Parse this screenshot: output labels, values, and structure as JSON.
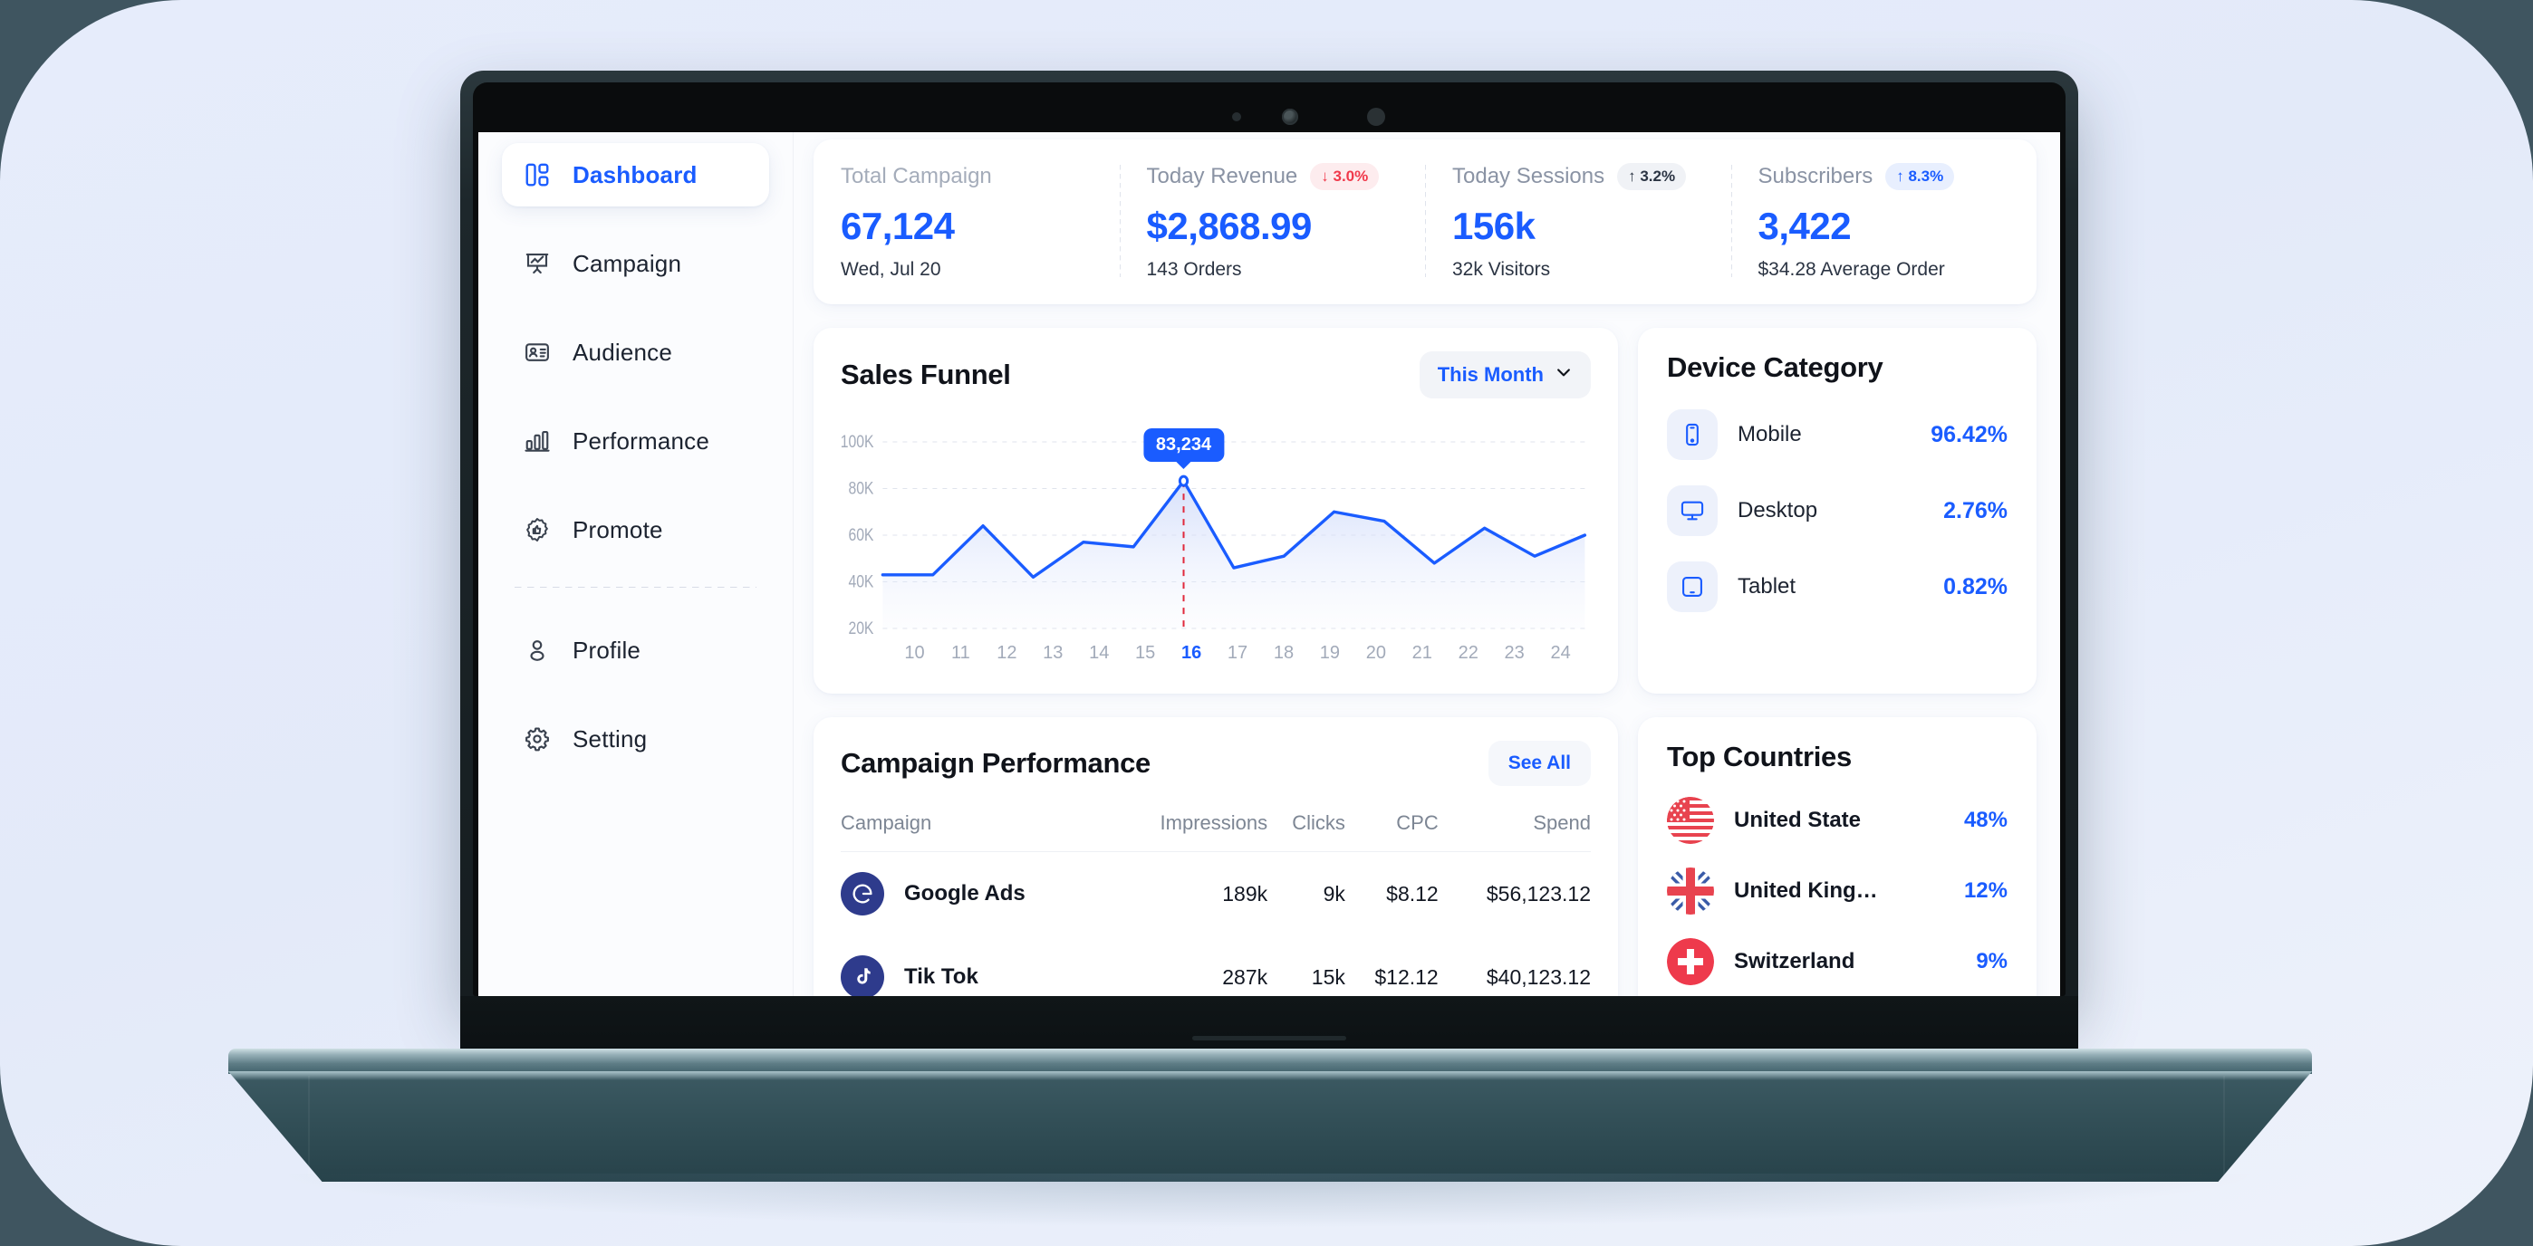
{
  "sidebar": {
    "items": [
      {
        "label": "Dashboard",
        "icon": "layout-grid-icon",
        "active": true
      },
      {
        "label": "Campaign",
        "icon": "presentation-chart-icon",
        "active": false
      },
      {
        "label": "Audience",
        "icon": "id-card-icon",
        "active": false
      },
      {
        "label": "Performance",
        "icon": "bar-chart-icon",
        "active": false
      },
      {
        "label": "Promote",
        "icon": "badge-thumbs-up-icon",
        "active": false
      },
      {
        "label": "Profile",
        "icon": "user-icon",
        "active": false
      },
      {
        "label": "Setting",
        "icon": "gear-icon",
        "active": false
      }
    ]
  },
  "kpis": [
    {
      "title": "Total Campaign",
      "value": "67,124",
      "sub": "Wed, Jul 20",
      "badge": "",
      "badge_type": "none"
    },
    {
      "title": "Today Revenue",
      "value": "$2,868.99",
      "sub": "143 Orders",
      "badge": "↓ 3.0%",
      "badge_type": "down"
    },
    {
      "title": "Today Sessions",
      "value": "156k",
      "sub": "32k Visitors",
      "badge": "↑ 3.2%",
      "badge_type": "neutral"
    },
    {
      "title": "Subscribers",
      "value": "3,422",
      "sub": "$34.28 Average Order",
      "badge": "↑ 8.3%",
      "badge_type": "up"
    }
  ],
  "funnel": {
    "title": "Sales Funnel",
    "range_label": "This Month",
    "range_icon": "chevron-down-icon",
    "tooltip": "83,234"
  },
  "chart_data": {
    "type": "area",
    "title": "Sales Funnel",
    "xlabel": "",
    "ylabel": "",
    "x": [
      10,
      11,
      12,
      13,
      14,
      15,
      16,
      17,
      18,
      19,
      20,
      21,
      22,
      23,
      24
    ],
    "categories": [
      "10",
      "11",
      "12",
      "13",
      "14",
      "15",
      "16",
      "17",
      "18",
      "19",
      "20",
      "21",
      "22",
      "23",
      "24"
    ],
    "values": [
      43000,
      43000,
      64000,
      42000,
      57000,
      55000,
      83234,
      46000,
      51000,
      70000,
      66000,
      48000,
      63000,
      51000,
      60000
    ],
    "ytick_labels": [
      "100K",
      "80K",
      "60K",
      "40K",
      "20K"
    ],
    "ytick_values": [
      100000,
      80000,
      60000,
      40000,
      20000
    ],
    "ylim": [
      20000,
      100000
    ],
    "grid": true,
    "legend": "none",
    "highlight_x": 16,
    "highlight_value": 83234,
    "highlight_label": "83,234",
    "line_color": "#1a5cff",
    "fill_color": "#dfe6fb"
  },
  "device": {
    "title": "Device Category",
    "rows": [
      {
        "name": "Mobile",
        "pct": "96.42%",
        "icon": "mobile-icon"
      },
      {
        "name": "Desktop",
        "pct": "2.76%",
        "icon": "desktop-icon"
      },
      {
        "name": "Tablet",
        "pct": "0.82%",
        "icon": "tablet-icon"
      }
    ]
  },
  "performance": {
    "title": "Campaign Performance",
    "see_all_label": "See All",
    "columns": [
      "Campaign",
      "Impressions",
      "Clicks",
      "CPC",
      "Spend"
    ],
    "rows": [
      {
        "icon": "google-icon",
        "name": "Google Ads",
        "impressions": "189k",
        "clicks": "9k",
        "cpc": "$8.12",
        "spend": "$56,123.12"
      },
      {
        "icon": "tiktok-icon",
        "name": "Tik Tok",
        "impressions": "287k",
        "clicks": "15k",
        "cpc": "$12.12",
        "spend": "$40,123.12"
      },
      {
        "icon": "instagram-icon",
        "name": "",
        "impressions": "",
        "clicks": "",
        "cpc": "",
        "spend": ""
      }
    ]
  },
  "countries": {
    "title": "Top Countries",
    "rows": [
      {
        "name": "United State",
        "pct": "48%",
        "flag": "us-flag-icon"
      },
      {
        "name": "United King…",
        "pct": "12%",
        "flag": "uk-flag-icon"
      },
      {
        "name": "Switzerland",
        "pct": "9%",
        "flag": "ch-flag-icon"
      }
    ]
  },
  "theme": {
    "accent": "#1a5cff",
    "page_bg": "#e3eaf9",
    "card_bg": "#ffffff",
    "down": "#f0394b",
    "icon_navy": "#2e3b8c"
  }
}
